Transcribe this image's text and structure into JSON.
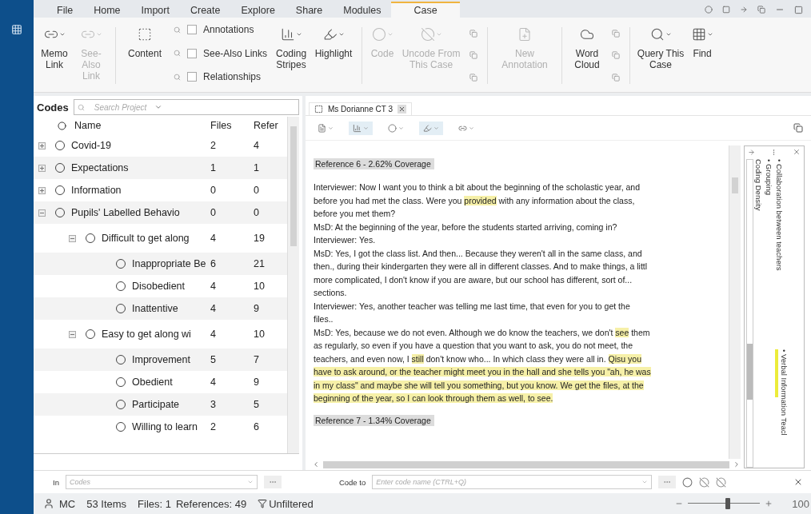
{
  "menu_tabs": [
    {
      "label": "File",
      "selected": false
    },
    {
      "label": "Home",
      "selected": false
    },
    {
      "label": "Import",
      "selected": false
    },
    {
      "label": "Create",
      "selected": false
    },
    {
      "label": "Explore",
      "selected": false
    },
    {
      "label": "Share",
      "selected": false
    },
    {
      "label": "Modules",
      "selected": false
    },
    {
      "label": "Case",
      "selected": true
    }
  ],
  "ribbon": [
    {
      "kind": "button",
      "label": "Memo Link",
      "disabled": false,
      "dropdown": true
    },
    {
      "kind": "button",
      "label": "See-Also Link",
      "disabled": true,
      "dropdown": true
    },
    {
      "kind": "separator"
    },
    {
      "kind": "button",
      "label": "Content",
      "disabled": false,
      "dropdown": false
    },
    {
      "kind": "checks",
      "items": [
        {
          "label": "Annotations",
          "checked": false
        },
        {
          "label": "See-Also Links",
          "checked": false
        },
        {
          "label": "Relationships",
          "checked": false
        }
      ]
    },
    {
      "kind": "button",
      "label": "Coding Stripes",
      "disabled": false,
      "dropdown": true
    },
    {
      "kind": "button",
      "label": "Highlight",
      "disabled": false,
      "dropdown": true
    },
    {
      "kind": "separator"
    },
    {
      "kind": "button",
      "label": "Code",
      "disabled": true,
      "dropdown": true
    },
    {
      "kind": "button",
      "label": "Uncode From This Case",
      "disabled": true,
      "dropdown": true
    },
    {
      "kind": "icon_stack"
    },
    {
      "kind": "separator"
    },
    {
      "kind": "button",
      "label": "New Annotation",
      "disabled": true,
      "dropdown": false
    },
    {
      "kind": "separator"
    },
    {
      "kind": "button",
      "label": "Word Cloud",
      "disabled": false,
      "dropdown": false
    },
    {
      "kind": "icon_stack"
    },
    {
      "kind": "separator"
    },
    {
      "kind": "button",
      "label": "Query This Case",
      "disabled": false,
      "dropdown": true
    },
    {
      "kind": "button",
      "label": "Find",
      "disabled": false,
      "dropdown": true
    }
  ],
  "codes_pane": {
    "title": "Codes",
    "search_placeholder": "Search Project",
    "columns": [
      "Name",
      "Files",
      "Refer"
    ],
    "rows": [
      {
        "name": "Covid-19",
        "files": "2",
        "refs": "4",
        "expanded": false
      },
      {
        "name": "Expectations",
        "files": "1",
        "refs": "1",
        "expanded": false
      },
      {
        "name": "Information",
        "files": "0",
        "refs": "0",
        "expanded": false
      },
      {
        "name": "Pupils' Labelled Behavio",
        "files": "0",
        "refs": "0",
        "expanded": true,
        "children": [
          {
            "name": "Difficult to get along",
            "files": "4",
            "refs": "19",
            "expanded": true,
            "children": [
              {
                "name": "Inappropriate Be",
                "files": "6",
                "refs": "21"
              },
              {
                "name": "Disobedient",
                "files": "4",
                "refs": "10"
              },
              {
                "name": "Inattentive",
                "files": "4",
                "refs": "9"
              }
            ]
          },
          {
            "name": "Easy to get along wi",
            "files": "4",
            "refs": "10",
            "expanded": true,
            "children": [
              {
                "name": "Improvement",
                "files": "5",
                "refs": "7"
              },
              {
                "name": "Obedient",
                "files": "4",
                "refs": "9"
              },
              {
                "name": "Participate",
                "files": "3",
                "refs": "5"
              },
              {
                "name": "Willing to learn",
                "files": "2",
                "refs": "6"
              }
            ]
          }
        ]
      }
    ]
  },
  "document": {
    "tab": "Ms Dorianne CT 3",
    "toolbar": [
      {
        "active": false
      },
      {
        "active": true
      },
      {
        "active": false
      },
      {
        "active": true
      },
      {
        "active": false
      }
    ],
    "content": [
      {
        "kind": "reference",
        "text": "Reference 6 - 2.62% Coverage"
      },
      {
        "kind": "line",
        "segments": [
          {
            "text": "Interviewer: Now I want you to think a bit about the beginning of the scholastic year, and",
            "highlighted": false
          }
        ]
      },
      {
        "kind": "line",
        "segments": [
          {
            "text": "before you had met the class. Were you ",
            "highlighted": false
          },
          {
            "text": "provided",
            "highlighted": true
          },
          {
            "text": " with any information about the class,",
            "highlighted": false
          }
        ]
      },
      {
        "kind": "line",
        "segments": [
          {
            "text": "before you met them?",
            "highlighted": false
          }
        ]
      },
      {
        "kind": "line",
        "segments": [
          {
            "text": "MsD: At the beginning of the year, before the students started arriving, coming in?",
            "highlighted": false
          }
        ]
      },
      {
        "kind": "line",
        "segments": [
          {
            "text": "Interviewer: Yes.",
            "highlighted": false
          }
        ]
      },
      {
        "kind": "line",
        "segments": [
          {
            "text": "MsD: Yes, I got the class list. And then... Because they weren't all in the same class, and",
            "highlighted": false
          }
        ]
      },
      {
        "kind": "line",
        "segments": [
          {
            "text": "then., during their kindergarten they were all in different classes. And to make things, a littl",
            "highlighted": false
          }
        ]
      },
      {
        "kind": "line",
        "segments": [
          {
            "text": "more complicated, I don't know if you are aware, but our school has different, sort of...",
            "highlighted": false
          }
        ]
      },
      {
        "kind": "line",
        "segments": [
          {
            "text": "sections.",
            "highlighted": false
          }
        ]
      },
      {
        "kind": "line",
        "segments": [
          {
            "text": "Interviewer: Yes, another teacher was telling me last time, that even for you to get the",
            "highlighted": false
          }
        ]
      },
      {
        "kind": "line",
        "segments": [
          {
            "text": "files..",
            "highlighted": false
          }
        ]
      },
      {
        "kind": "line",
        "segments": [
          {
            "text": "MsD: Yes, because we do not even. Although we do know the teachers, we don't ",
            "highlighted": false
          },
          {
            "text": "see",
            "highlighted": true
          },
          {
            "text": " them",
            "highlighted": false
          }
        ]
      },
      {
        "kind": "line",
        "segments": [
          {
            "text": "as regularly, so even if you have a question that you want to ask, you do not meet, the",
            "highlighted": false
          }
        ]
      },
      {
        "kind": "line",
        "segments": [
          {
            "text": "teachers, and even now, I ",
            "highlighted": false
          },
          {
            "text": "still",
            "highlighted": true
          },
          {
            "text": " don't know who... In which class they were all in. ",
            "highlighted": false
          },
          {
            "text": "Qisu you",
            "highlighted": true
          }
        ]
      },
      {
        "kind": "line",
        "segments": [
          {
            "text": "have to ask around, or the teacher might meet you in the hall and she tells you \"ah, he was",
            "highlighted": true
          }
        ]
      },
      {
        "kind": "line",
        "segments": [
          {
            "text": "in my class\" and maybe she will tell you something, but you know. We get the files, at the",
            "highlighted": true
          }
        ]
      },
      {
        "kind": "line",
        "segments": [
          {
            "text": "beginning of the year, so I can look through them as well, to see.",
            "highlighted": true
          }
        ]
      },
      {
        "kind": "reference",
        "text": "Reference 7 - 1.34% Coverage"
      }
    ],
    "stripes": {
      "density_label": "Coding Density",
      "items": [
        {
          "label": "• Grouping"
        },
        {
          "label": "• Collaboration between teachers"
        },
        {
          "label": "• Verbal Information Teacl",
          "color": "#ecec3a"
        }
      ]
    }
  },
  "bottom_bar": {
    "in_label": "In",
    "in_placeholder": "Codes",
    "code_to_label": "Code to",
    "code_to_placeholder": "Enter code name (CTRL+Q)"
  },
  "status_bar": {
    "user": "MC",
    "items": "53 Items",
    "files": "Files: 1",
    "references": "References: 49",
    "filter": "Unfiltered",
    "zoom": {
      "level": 0.55
    },
    "zoom_text": "100"
  }
}
